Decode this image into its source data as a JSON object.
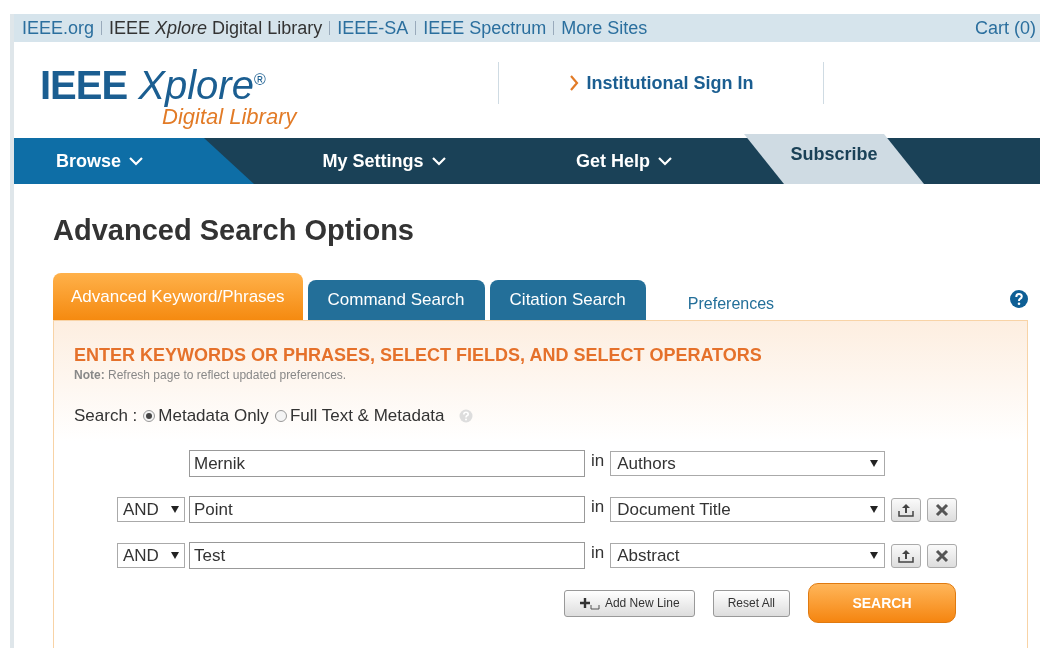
{
  "top_links": [
    {
      "text": "IEEE.org",
      "kind": "link"
    },
    {
      "text": "IEEE *Xplore* Digital Library",
      "kind": "plain"
    },
    {
      "text": "IEEE-SA",
      "kind": "link"
    },
    {
      "text": "IEEE Spectrum",
      "kind": "link"
    },
    {
      "text": "More Sites",
      "kind": "link"
    }
  ],
  "cart": "Cart (0)",
  "logo": {
    "name": "IEEE",
    "product": "Xplore",
    "mark": "®",
    "subtitle": "Digital Library"
  },
  "sign_in": "Institutional Sign In",
  "nav": [
    {
      "label": "Browse",
      "kind": "menu",
      "selected": true
    },
    {
      "label": "My Settings",
      "kind": "menu",
      "selected": false
    },
    {
      "label": "Get Help",
      "kind": "menu",
      "selected": false
    },
    {
      "label": "Subscribe",
      "kind": "subscribe",
      "selected": false
    }
  ],
  "page_title": "Advanced Search Options",
  "tabs": [
    {
      "label": "Advanced Keyword/Phrases",
      "kind": "tab",
      "selected": true
    },
    {
      "label": "Command Search",
      "kind": "tab",
      "selected": false
    },
    {
      "label": "Citation Search",
      "kind": "tab",
      "selected": false
    },
    {
      "label": "Preferences",
      "kind": "link",
      "selected": false
    }
  ],
  "panel": {
    "heading": "ENTER KEYWORDS OR PHRASES, SELECT FIELDS, AND SELECT OPERATORS",
    "note": "**Note:** Refresh page to reflect updated preferences.",
    "search_label": "Search :",
    "scope": [
      {
        "label": "Metadata Only",
        "selected": true
      },
      {
        "label": "Full Text & Metadata",
        "selected": false
      }
    ],
    "rows": [
      {
        "value": "Mernik",
        "in": "in",
        "field": "Authors",
        "removable": false
      },
      {
        "operator": "AND",
        "value": "Point",
        "in": "in",
        "field": "Document Title",
        "removable": true
      },
      {
        "operator": "AND",
        "value": "Test",
        "in": "in",
        "field": "Abstract",
        "removable": true
      }
    ],
    "buttons": [
      {
        "label": "Add New Line",
        "kind": "add"
      },
      {
        "label": "Reset All",
        "kind": "plain"
      },
      {
        "label": "SEARCH",
        "kind": "primary"
      }
    ]
  }
}
